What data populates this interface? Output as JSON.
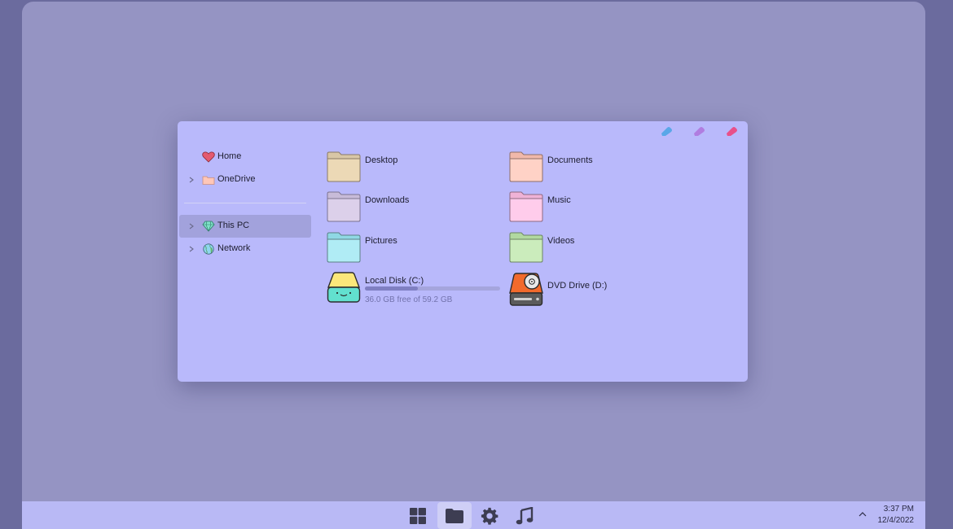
{
  "window": {
    "controls": [
      {
        "name": "minimize-button",
        "color": "#5aa7e8"
      },
      {
        "name": "maximize-button",
        "color": "#b07de0"
      },
      {
        "name": "close-button",
        "color": "#e8508a"
      }
    ]
  },
  "sidebar": {
    "items": [
      {
        "label": "Home",
        "icon": "heart-icon",
        "expandable": false
      },
      {
        "label": "OneDrive",
        "icon": "folder-icon",
        "expandable": true
      },
      {
        "label": "This PC",
        "icon": "diamond-icon",
        "expandable": true,
        "selected": true
      },
      {
        "label": "Network",
        "icon": "globe-icon",
        "expandable": true
      }
    ]
  },
  "folders": [
    {
      "label": "Desktop",
      "color": "#ecd9b6"
    },
    {
      "label": "Documents",
      "color": "#ffd2c6"
    },
    {
      "label": "Downloads",
      "color": "#dcd0ea"
    },
    {
      "label": "Music",
      "color": "#ffcceb"
    },
    {
      "label": "Pictures",
      "color": "#b0ecf5"
    },
    {
      "label": "Videos",
      "color": "#cbecbc"
    }
  ],
  "drives": {
    "c": {
      "label": "Local Disk (C:)",
      "free_text": "36.0 GB free of 59.2 GB",
      "used_fraction": 0.39
    },
    "d": {
      "label": "DVD Drive (D:)"
    }
  },
  "taskbar": {
    "apps": [
      "start-icon",
      "file-explorer-icon",
      "settings-gear-icon",
      "music-note-icon"
    ],
    "active": "file-explorer-icon",
    "time": "3:37 PM",
    "date": "12/4/2022"
  }
}
